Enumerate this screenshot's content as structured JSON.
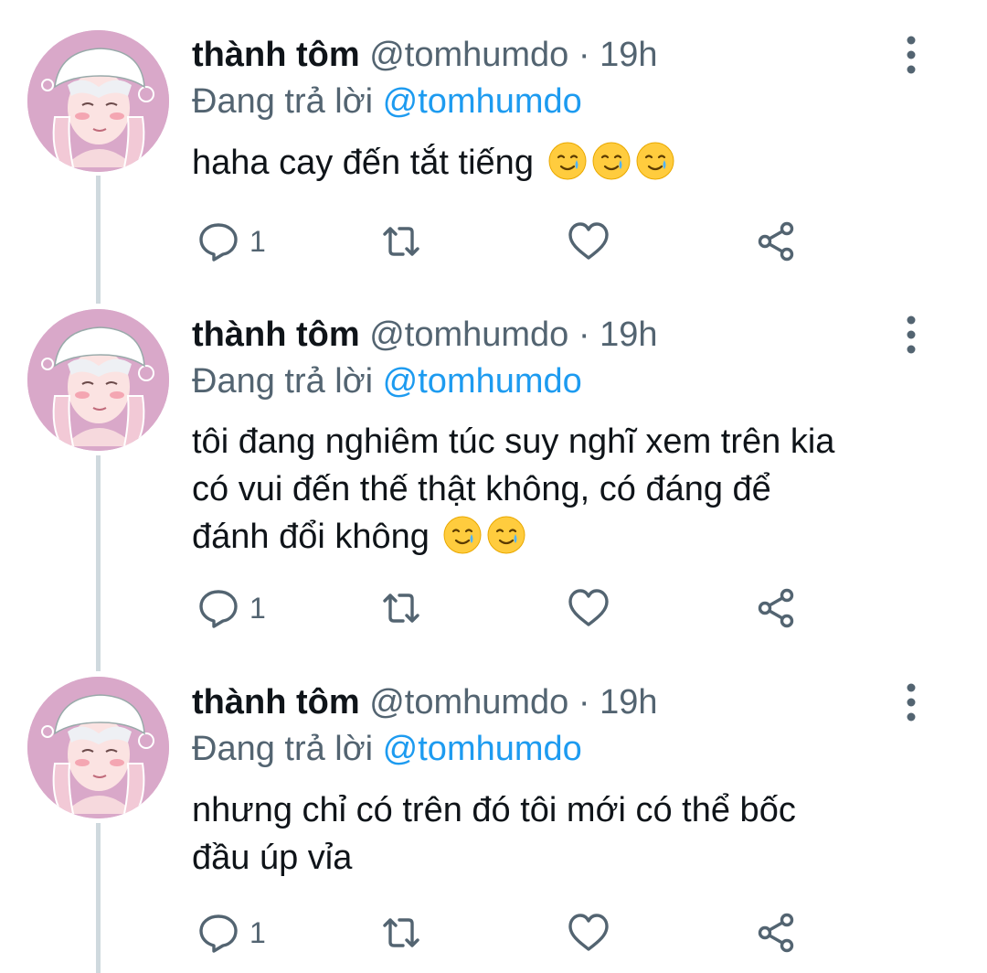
{
  "colors": {
    "accent": "#1d9bf0",
    "muted": "#536471",
    "text": "#0f1419",
    "thread": "#cfd9de"
  },
  "tweets": [
    {
      "name": "thành tôm",
      "handle": "@tomhumdo",
      "separator": "·",
      "time": "19h",
      "reply_prefix": "Đang trả lời",
      "reply_to": "@tomhumdo",
      "lines": [
        "haha cay đến tắt tiếng"
      ],
      "emoji": [
        "face-holding-back-tears",
        "face-holding-back-tears",
        "face-holding-back-tears"
      ],
      "reply_count": "1"
    },
    {
      "name": "thành tôm",
      "handle": "@tomhumdo",
      "separator": "·",
      "time": "19h",
      "reply_prefix": "Đang trả lời",
      "reply_to": "@tomhumdo",
      "lines": [
        "tôi đang nghiêm túc suy nghĩ xem trên kia",
        "có vui đến thế thật không, có đáng để",
        "đánh đổi không"
      ],
      "emoji": [
        "face-holding-back-tears",
        "face-holding-back-tears"
      ],
      "reply_count": "1"
    },
    {
      "name": "thành tôm",
      "handle": "@tomhumdo",
      "separator": "·",
      "time": "19h",
      "reply_prefix": "Đang trả lời",
      "reply_to": "@tomhumdo",
      "lines": [
        "nhưng chỉ có trên đó tôi mới có thể bốc",
        "đầu úp vỉa"
      ],
      "emoji": [],
      "reply_count": "1"
    }
  ],
  "icons": {
    "reply": "comment-icon",
    "retweet": "retweet-icon",
    "like": "heart-icon",
    "share": "share-icon",
    "more": "more-vertical-icon"
  }
}
